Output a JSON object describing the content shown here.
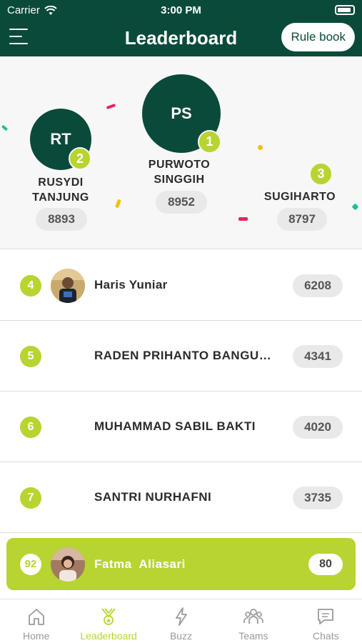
{
  "status_bar": {
    "carrier": "Carrier",
    "time": "3:00 PM"
  },
  "header": {
    "title": "Leaderboard",
    "rulebook_label": "Rule book"
  },
  "podium": {
    "first": {
      "initials": "PS",
      "rank": "1",
      "name_line1": "PURWOTO",
      "name_line2": "SINGGIH",
      "score": "8952"
    },
    "second": {
      "initials": "RT",
      "rank": "2",
      "name_line1": "RUSYDI",
      "name_line2": "TANJUNG",
      "score": "8893"
    },
    "third": {
      "rank": "3",
      "name_line1": "SUGIHARTO",
      "score": "8797"
    }
  },
  "list": [
    {
      "rank": "4",
      "name": "Haris Yuniar",
      "score": "6208"
    },
    {
      "rank": "5",
      "name": "RADEN PRIHANTO BANGUNRAJA",
      "score": "4341"
    },
    {
      "rank": "6",
      "name": "MUHAMMAD SABIL BAKTI",
      "score": "4020"
    },
    {
      "rank": "7",
      "name": "SANTRI NURHAFNI",
      "score": "3735"
    }
  ],
  "current_user": {
    "rank": "92",
    "name": "Fatma  Aliasari",
    "score": "80"
  },
  "tabs": [
    {
      "label": "Home",
      "icon": "home-icon"
    },
    {
      "label": "Leaderboard",
      "icon": "trophy-icon"
    },
    {
      "label": "Buzz",
      "icon": "lightning-icon"
    },
    {
      "label": "Teams",
      "icon": "team-icon"
    },
    {
      "label": "Chats",
      "icon": "chat-icon"
    }
  ],
  "colors": {
    "brand": "#0a4a3a",
    "accent": "#b7d431",
    "pill": "#e9e9e9"
  }
}
